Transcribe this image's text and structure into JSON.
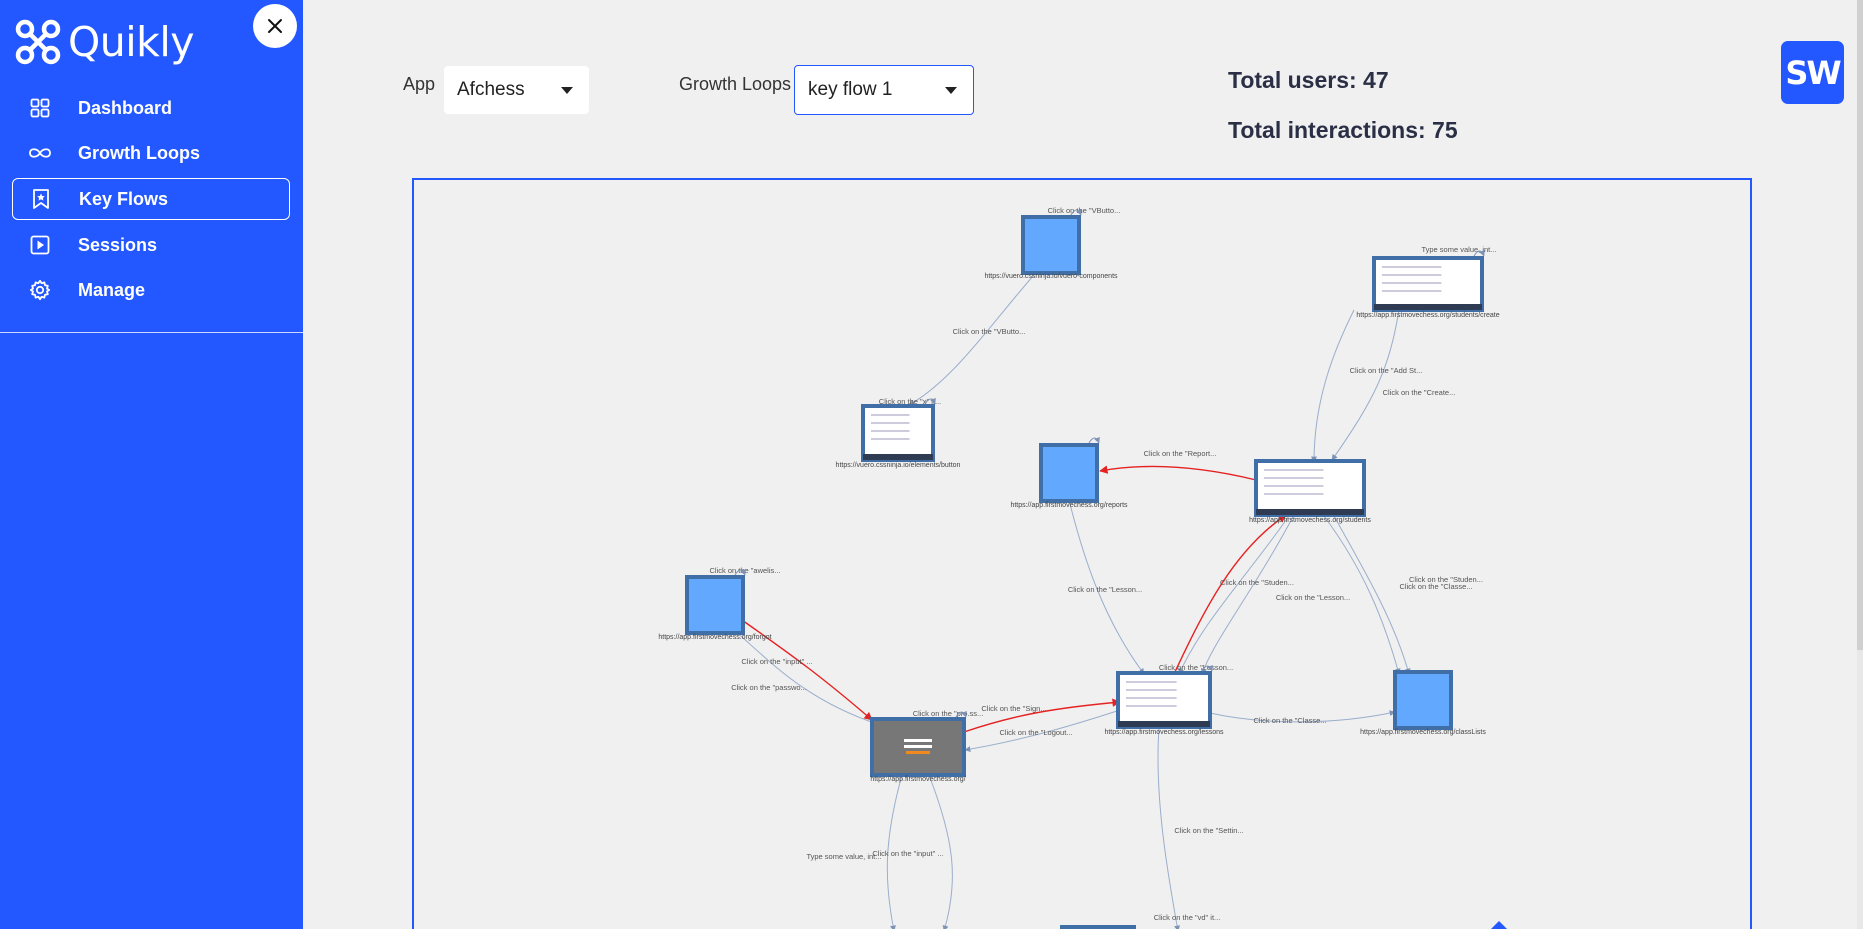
{
  "app": {
    "name": "Quikly"
  },
  "sidebar": {
    "items": [
      {
        "label": "Dashboard",
        "icon": "grid-icon",
        "active": false
      },
      {
        "label": "Growth Loops",
        "icon": "infinity-icon",
        "active": false
      },
      {
        "label": "Key Flows",
        "icon": "bookmark-star-icon",
        "active": true
      },
      {
        "label": "Sessions",
        "icon": "play-square-icon",
        "active": false
      },
      {
        "label": "Manage",
        "icon": "gear-icon",
        "active": false
      }
    ]
  },
  "filters": {
    "app_label": "App",
    "app_value": "Afchess",
    "loops_label": "Growth Loops",
    "loops_value": "key flow 1"
  },
  "stats": {
    "total_users": "Total users: 47",
    "total_interactions": "Total interactions: 75"
  },
  "user": {
    "initials": "SW"
  },
  "colors": {
    "brand": "#2357ff",
    "node": "#62a8ff",
    "node_border": "#3f6fa6",
    "edge": "#9aaecb",
    "edge_highlight": "#e52222"
  },
  "graph": {
    "nodes": [
      {
        "id": "n1",
        "label": "https://vuero.cssninja.io/vuero-components",
        "top_label": "Click on the \"VButto..."
      },
      {
        "id": "n2",
        "label": "https://app.firstmovechess.org/students/create",
        "top_label": "Type some value, int..."
      },
      {
        "id": "n3",
        "label": "https://vuero.cssninja.io/elements/button",
        "top_label": "Click on the \"x\" it..."
      },
      {
        "id": "n4",
        "label": "https://app.firstmovechess.org/reports",
        "top_label": "Click on the \"Report..."
      },
      {
        "id": "n5",
        "label": "https://app.firstmovechess.org/students",
        "top_label": ""
      },
      {
        "id": "n6",
        "label": "https://app.firstmovechess.org/forgot",
        "top_label": "Click on the \"awelis..."
      },
      {
        "id": "n7",
        "label": "https://app.firstmovechess.org/lessons",
        "top_label": "Click on the \"Lesson..."
      },
      {
        "id": "n8",
        "label": "https://app.firstmovechess.org/classLists",
        "top_label": ""
      },
      {
        "id": "n9",
        "label": "https://app.firstmovechess.org/",
        "top_label": "Click on the \"pro.ss..."
      }
    ],
    "edge_labels": [
      "Click on the \"VButto...",
      "Click on the \"Add St...",
      "Click on the \"Create...",
      "Click on the \"Lesson...",
      "Click on the \"Studen...",
      "Click on the \"Lesson...",
      "Click on the \"Studen...",
      "Click on the \"Classe...",
      "Click on the \"input\" ...",
      "Click on the \"passwo...",
      "Click on the \"Sign...",
      "Click on the \"Logout...",
      "Click on the \"Classe...",
      "Click on the \"Settin...",
      "Type some value, int...",
      "Click on the \"input\" ...",
      "Click on the \"vd\" it..."
    ]
  }
}
